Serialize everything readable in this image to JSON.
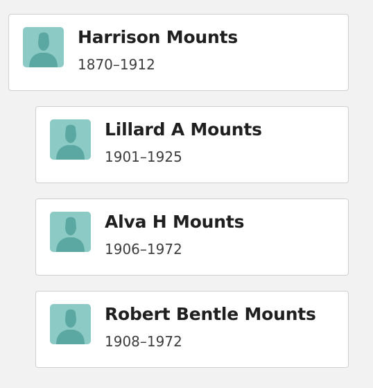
{
  "icons": {
    "avatar": "person-silhouette-icon",
    "avatar_bg": "#8ccac6",
    "avatar_fg": "#5ba8a3"
  },
  "parent": {
    "name": "Harrison Mounts",
    "dates": "1870–1912"
  },
  "children": [
    {
      "name": "Lillard A Mounts",
      "dates": "1901–1925"
    },
    {
      "name": "Alva H Mounts",
      "dates": "1906–1972"
    },
    {
      "name": "Robert Bentle Mounts",
      "dates": "1908–1972"
    }
  ]
}
